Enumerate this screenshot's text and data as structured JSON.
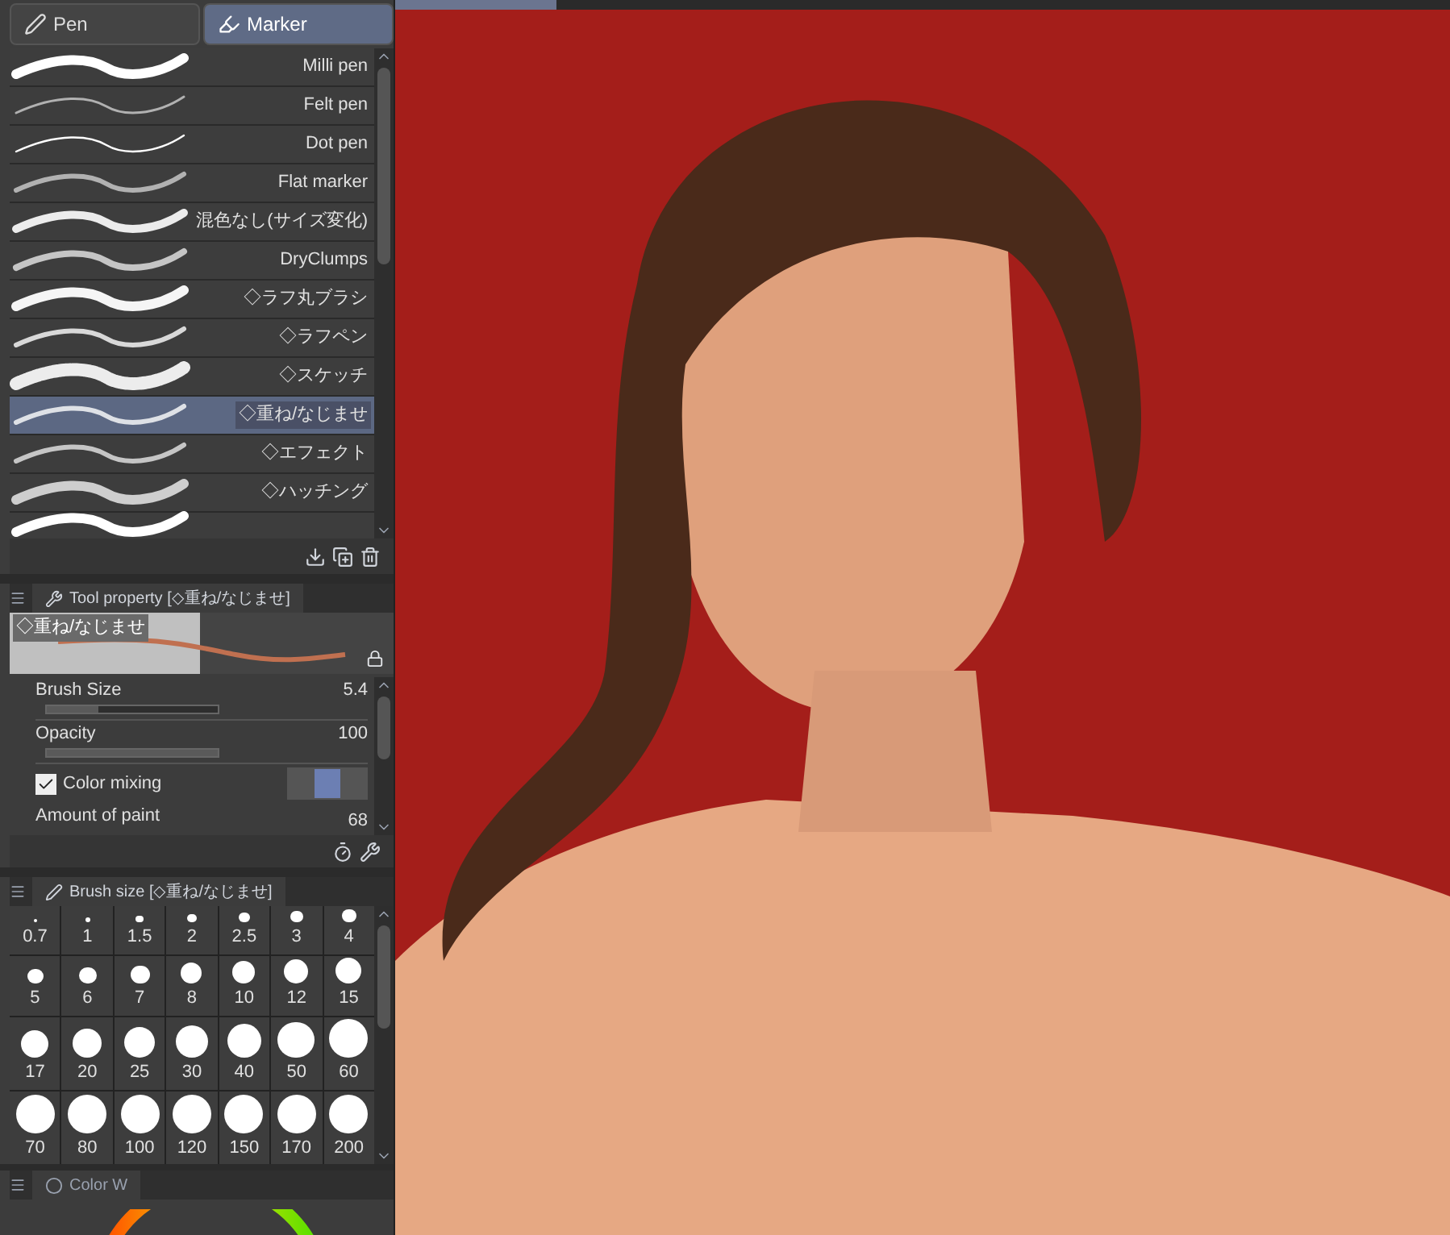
{
  "tool_tabs": [
    {
      "label": "Pen",
      "selected": false
    },
    {
      "label": "Marker",
      "selected": true
    }
  ],
  "brushes": [
    {
      "label": "Milli pen",
      "selected": false
    },
    {
      "label": "Felt pen",
      "selected": false
    },
    {
      "label": "Dot pen",
      "selected": false
    },
    {
      "label": "Flat marker",
      "selected": false
    },
    {
      "label": "混色なし(サイズ変化)",
      "selected": false
    },
    {
      "label": "DryClumps",
      "selected": false
    },
    {
      "label": "◇ラフ丸ブラシ",
      "selected": false
    },
    {
      "label": "◇ラフペン",
      "selected": false
    },
    {
      "label": "◇スケッチ",
      "selected": false
    },
    {
      "label": "◇重ね/なじませ",
      "selected": true
    },
    {
      "label": "◇エフェクト",
      "selected": false
    },
    {
      "label": "◇ハッチング",
      "selected": false
    }
  ],
  "tool_property": {
    "title": "Tool property [◇重ね/なじませ]",
    "preview_label": "◇重ね/なじませ",
    "properties": [
      {
        "kind": "slider",
        "label": "Brush Size",
        "value": "5.4",
        "level": 0.3
      },
      {
        "kind": "slider",
        "label": "Opacity",
        "value": "100",
        "level": 1
      },
      {
        "kind": "check",
        "label": "Color mixing",
        "checked": true
      },
      {
        "kind": "partial",
        "label": "Amount of paint",
        "value": "68"
      }
    ]
  },
  "brush_size": {
    "title": "Brush size [◇重ね/なじませ]",
    "sizes": [
      {
        "label": "0.7",
        "selected": false
      },
      {
        "label": "1",
        "selected": false
      },
      {
        "label": "1.5",
        "selected": false
      },
      {
        "label": "2",
        "selected": false
      },
      {
        "label": "2.5",
        "selected": false
      },
      {
        "label": "3",
        "selected": false
      },
      {
        "label": "4",
        "selected": false
      },
      {
        "label": "5",
        "selected": false
      },
      {
        "label": "6",
        "selected": false
      },
      {
        "label": "7",
        "selected": false
      },
      {
        "label": "8",
        "selected": false
      },
      {
        "label": "10",
        "selected": false
      },
      {
        "label": "12",
        "selected": false
      },
      {
        "label": "15",
        "selected": false
      },
      {
        "label": "17",
        "selected": false
      },
      {
        "label": "20",
        "selected": false
      },
      {
        "label": "25",
        "selected": false
      },
      {
        "label": "30",
        "selected": false
      },
      {
        "label": "40",
        "selected": false
      },
      {
        "label": "50",
        "selected": false
      },
      {
        "label": "60",
        "selected": false
      },
      {
        "label": "70",
        "selected": false
      },
      {
        "label": "80",
        "selected": false
      },
      {
        "label": "100",
        "selected": false
      },
      {
        "label": "120",
        "selected": false
      },
      {
        "label": "150",
        "selected": false
      },
      {
        "label": "170",
        "selected": false
      },
      {
        "label": "200",
        "selected": false
      }
    ]
  },
  "color_panel": {
    "title": "Color W"
  }
}
